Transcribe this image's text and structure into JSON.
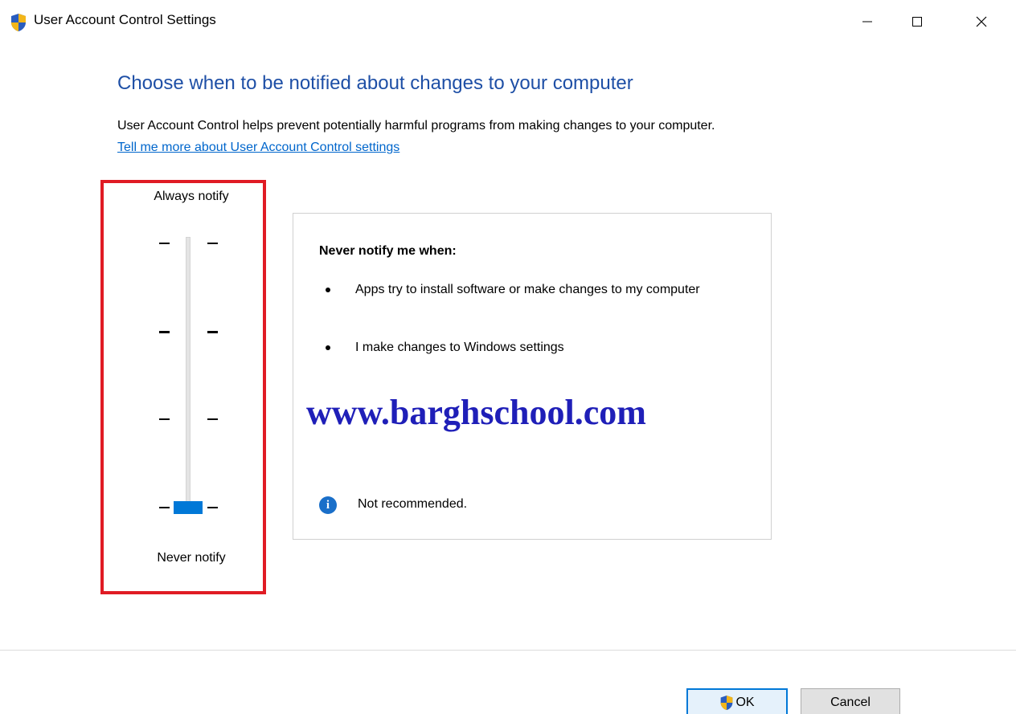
{
  "window": {
    "title": "User Account Control Settings",
    "icon": "uac-shield-icon"
  },
  "heading": "Choose when to be notified about changes to your computer",
  "description": "User Account Control helps prevent potentially harmful programs from making changes to your computer.",
  "help_link": "Tell me more about User Account Control settings",
  "slider": {
    "top_label": "Always notify",
    "bottom_label": "Never notify",
    "levels": 4,
    "selected_level": 1,
    "thumb_color": "#0078d7"
  },
  "panel": {
    "heading": "Never notify me when:",
    "bullets": [
      "Apps try to install software or make changes to my computer",
      "I make changes to Windows settings"
    ],
    "watermark": "www.barghschool.com",
    "note_icon": "info-icon",
    "note": "Not recommended."
  },
  "highlight_color": "#e01b24",
  "buttons": {
    "ok": "OK",
    "cancel": "Cancel"
  }
}
